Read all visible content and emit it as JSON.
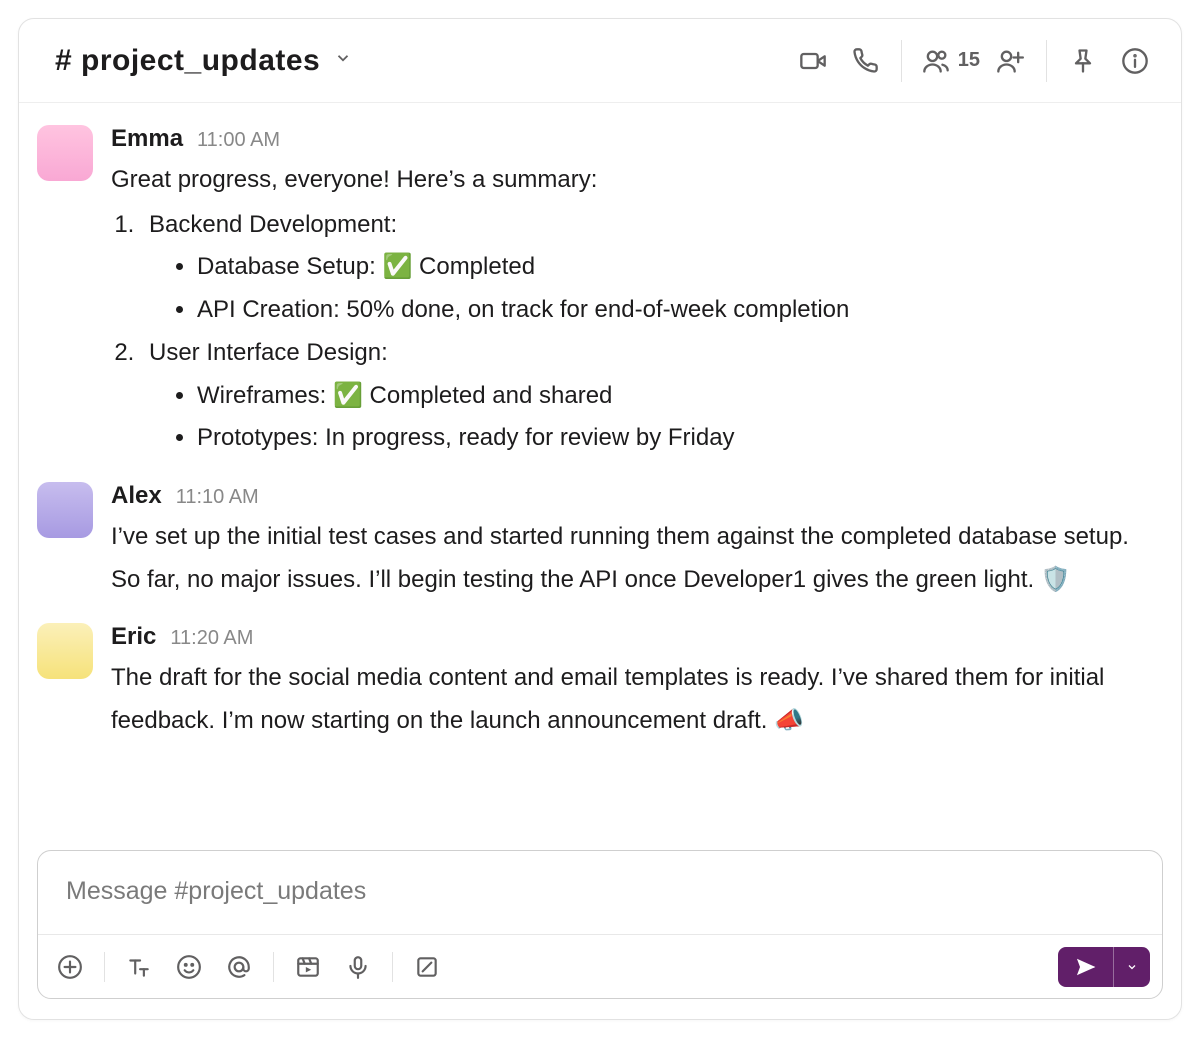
{
  "channel": {
    "name": "# project_updates"
  },
  "header": {
    "member_count": "15"
  },
  "messages": [
    {
      "author": "Emma",
      "time": "11:00 AM",
      "intro": "Great progress, everyone! Here’s a summary:",
      "sections": [
        {
          "title": "Backend Development:",
          "items": [
            "Database Setup: ✅ Completed",
            "API Creation: 50% done, on track for end-of-week completion"
          ]
        },
        {
          "title": "User Interface Design:",
          "items": [
            "Wireframes: ✅ Completed and shared",
            "Prototypes: In progress, ready for review by Friday"
          ]
        }
      ]
    },
    {
      "author": "Alex",
      "time": "11:10 AM",
      "text": "I’ve set up the initial test cases and started running them against the completed database setup. So far, no major issues. I’ll begin testing the API once Developer1 gives the green light. 🛡️"
    },
    {
      "author": "Eric",
      "time": "11:20 AM",
      "text": "The draft for the social media content and email templates is ready. I’ve shared them for initial feedback. I’m now starting on the launch announcement draft. 📣"
    }
  ],
  "composer": {
    "placeholder": "Message #project_updates"
  }
}
